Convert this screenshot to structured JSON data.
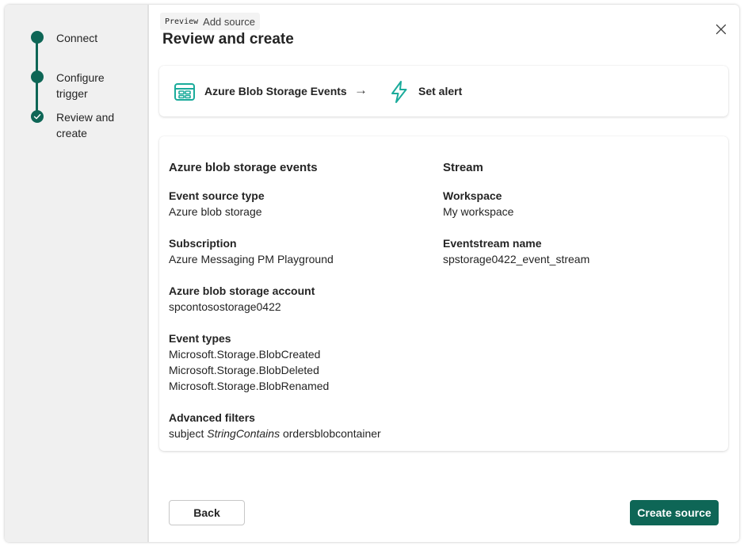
{
  "wizard": {
    "steps": [
      {
        "label_line1": "Connect",
        "label_line2": "",
        "state": "complete"
      },
      {
        "label_line1": "Configure",
        "label_line2": "trigger",
        "state": "complete"
      },
      {
        "label_line1": "Review and",
        "label_line2": "create",
        "state": "current"
      }
    ]
  },
  "header": {
    "preview_tag": "Preview",
    "subtitle": "Add source",
    "title": "Review and create"
  },
  "flow": {
    "source_label": "Azure Blob Storage Events",
    "source_icon": "blob-storage-events-icon",
    "arrow": "→",
    "target_label": "Set alert",
    "target_icon": "lightning-icon"
  },
  "details": {
    "source": {
      "title": "Azure blob storage events",
      "fields": [
        {
          "label": "Event source type",
          "values": [
            "Azure blob storage"
          ]
        },
        {
          "label": "Subscription",
          "values": [
            "Azure Messaging PM Playground"
          ]
        },
        {
          "label": "Azure blob storage account",
          "values": [
            "spcontosostorage0422"
          ]
        },
        {
          "label": "Event types",
          "values": [
            "Microsoft.Storage.BlobCreated",
            "Microsoft.Storage.BlobDeleted",
            "Microsoft.Storage.BlobRenamed"
          ]
        }
      ],
      "advanced_filters": {
        "label": "Advanced filters",
        "key": "subject",
        "operator": "StringContains",
        "value": "ordersblobcontainer"
      }
    },
    "stream": {
      "title": "Stream",
      "fields": [
        {
          "label": "Workspace",
          "values": [
            "My workspace"
          ]
        },
        {
          "label": "Eventstream name",
          "values": [
            "spstorage0422_event_stream"
          ]
        }
      ]
    }
  },
  "footer": {
    "back_label": "Back",
    "create_label": "Create source"
  },
  "colors": {
    "accent": "#0e6656",
    "sidebar_bg": "#f0f0f0",
    "icon_teal": "#1aab9b"
  }
}
